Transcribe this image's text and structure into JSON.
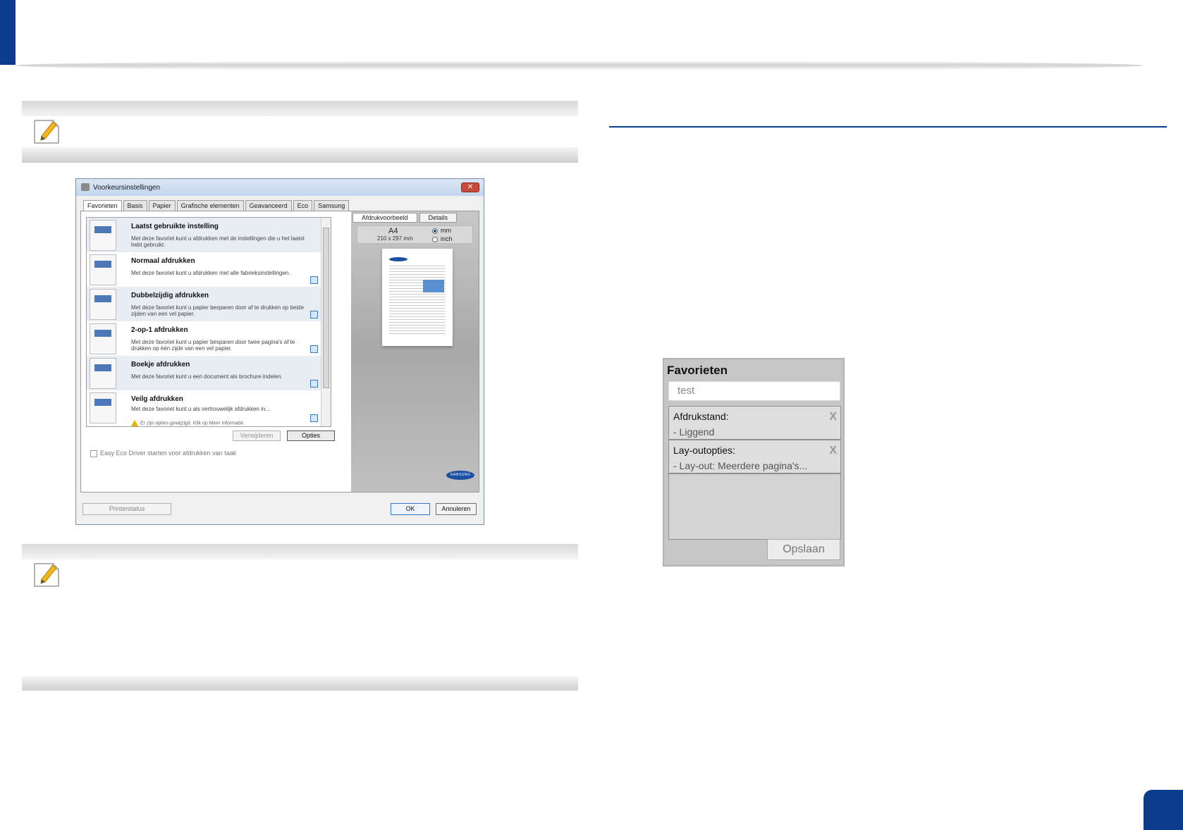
{
  "dialog": {
    "title": "Voorkeursinstellingen",
    "close_label": "✕",
    "tabs": [
      "Favorieten",
      "Basis",
      "Papier",
      "Grafische elementen",
      "Geavanceerd",
      "Eco",
      "Samsung"
    ],
    "favorites": [
      {
        "name": "Laatst gebruikte instelling",
        "desc": "Met deze favoriet kunt u afdrukken met de instellingen die u het laatst hebt gebruikt."
      },
      {
        "name": "Normaal afdrukken",
        "desc": "Met deze favoriet kunt u afdrukken met alle fabrieksinstellingen."
      },
      {
        "name": "Dubbelzijdig afdrukken",
        "desc": "Met deze favoriet kunt u papier besparen door af te drukken op beide zijden van een vel papier."
      },
      {
        "name": "2-op-1 afdrukken",
        "desc": "Met deze favoriet kunt u papier besparen door twee pagina's af te drukken op één zijde van een vel papier."
      },
      {
        "name": "Boekje afdrukken",
        "desc": "Met deze favoriet kunt u een document als brochure indelen."
      },
      {
        "name": "Veilg afdrukken",
        "desc": "Met deze favoriet kunt u als vertrouwelijk afdrukken in...",
        "warning": "Er zijn opties gewijzigd. Klik op Meer informatie."
      }
    ],
    "remove_label": "Verwijderen",
    "options_label": "Opties",
    "eco_label": "Easy Eco Driver starten voor afdrukken van taak",
    "preview_tabs": [
      "Afdrukvoorbeeld",
      "Details"
    ],
    "paper_size": "A4",
    "paper_dims": "210 x 297 mm",
    "unit_mm": "mm",
    "unit_inch": "inch",
    "brand": "SAMSUNG",
    "printer_status_label": "Printerstatus",
    "ok_label": "OK",
    "cancel_label": "Annuleren"
  },
  "favorites_panel": {
    "title": "Favorieten",
    "name_value": "test",
    "settings": [
      {
        "label": "Afdrukstand:",
        "value": "- Liggend"
      },
      {
        "label": "Lay-outopties:",
        "value": "- Lay-out: Meerdere pagina's..."
      }
    ],
    "remove_symbol": "X",
    "save_label": "Opslaan"
  },
  "colors": {
    "accent": "#0b3d8c"
  }
}
